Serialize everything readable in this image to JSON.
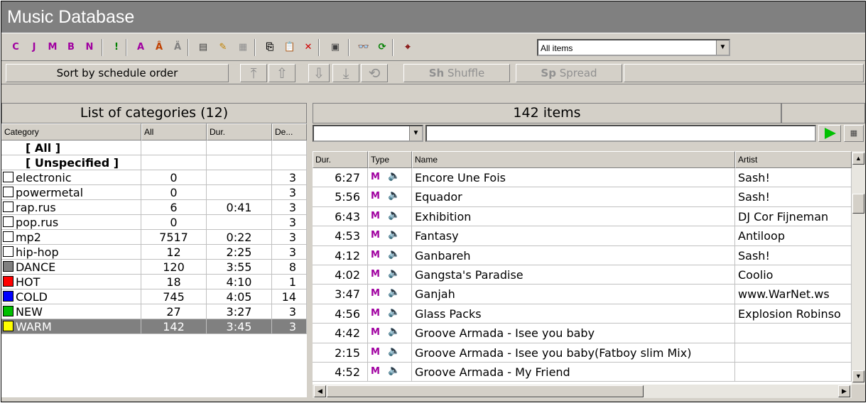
{
  "window": {
    "title": "Music Database"
  },
  "toolbar": {
    "buttons": [
      {
        "glyph": "C",
        "icon": "category-c-icon",
        "color": "#a000a0"
      },
      {
        "glyph": "J",
        "icon": "category-j-icon",
        "color": "#a000a0"
      },
      {
        "glyph": "M",
        "icon": "category-m-icon",
        "color": "#a000a0"
      },
      {
        "glyph": "B",
        "icon": "category-b-icon",
        "color": "#a000a0"
      },
      {
        "glyph": "N",
        "icon": "category-n-icon",
        "color": "#a000a0"
      },
      {
        "glyph": "!",
        "icon": "priority-icon",
        "color": "#008000"
      },
      {
        "glyph": "A",
        "icon": "category-a-icon",
        "color": "#a000a0"
      },
      {
        "glyph": "Â",
        "icon": "category-a2-icon",
        "color": "#c04000"
      },
      {
        "glyph": "Ä",
        "icon": "category-a3-icon",
        "color": "#808080"
      },
      {
        "glyph": "▤",
        "icon": "new-item-icon",
        "color": "#404040"
      },
      {
        "glyph": "✎",
        "icon": "edit-item-icon",
        "color": "#c08000"
      },
      {
        "glyph": "▦",
        "icon": "properties-disabled-icon",
        "color": "#909090"
      },
      {
        "glyph": "⎘",
        "icon": "copy-icon",
        "color": "#000000"
      },
      {
        "glyph": "📋",
        "icon": "paste-icon",
        "color": "#000000"
      },
      {
        "glyph": "✕",
        "icon": "delete-icon",
        "color": "#d00000"
      },
      {
        "glyph": "▣",
        "icon": "settings-icon",
        "color": "#404040"
      },
      {
        "glyph": "👓",
        "icon": "find-icon",
        "color": "#000000"
      },
      {
        "glyph": "⟳",
        "icon": "refresh-icon",
        "color": "#008000"
      },
      {
        "glyph": "⌖",
        "icon": "tool-icon",
        "color": "#800000"
      }
    ],
    "filter_value": "All items"
  },
  "sortbar": {
    "sort_label": "Sort by schedule order",
    "move_top": "⤒",
    "move_up": "⇧",
    "move_down": "⇩",
    "move_bottom": "⤓",
    "loop": "⟲",
    "shuffle_prefix": "Sh",
    "shuffle_label": "Shuffle",
    "spread_prefix": "Sp",
    "spread_label": "Spread"
  },
  "categories": {
    "header": "List of categories (12)",
    "columns": [
      "Category",
      "All",
      "Dur.",
      "De..."
    ],
    "rows": [
      {
        "name": "[ All ]",
        "all": "",
        "dur": "",
        "de": "",
        "bold": true,
        "color": null
      },
      {
        "name": "[ Unspecified ]",
        "all": "",
        "dur": "",
        "de": "",
        "bold": true,
        "color": null
      },
      {
        "name": "electronic",
        "all": "0",
        "dur": "",
        "de": "3",
        "color": "#ffffff"
      },
      {
        "name": "powermetal",
        "all": "0",
        "dur": "",
        "de": "3",
        "color": "#ffffff"
      },
      {
        "name": "rap.rus",
        "all": "6",
        "dur": "0:41",
        "de": "3",
        "color": "#ffffff"
      },
      {
        "name": "pop.rus",
        "all": "0",
        "dur": "",
        "de": "3",
        "color": "#ffffff"
      },
      {
        "name": "mp2",
        "all": "7517",
        "dur": "0:22",
        "de": "3",
        "color": "#ffffff"
      },
      {
        "name": "hip-hop",
        "all": "12",
        "dur": "2:25",
        "de": "3",
        "color": "#ffffff"
      },
      {
        "name": "DANCE",
        "all": "120",
        "dur": "3:55",
        "de": "8",
        "color": "#808080"
      },
      {
        "name": "HOT",
        "all": "18",
        "dur": "4:10",
        "de": "1",
        "color": "#ff0000"
      },
      {
        "name": "COLD",
        "all": "745",
        "dur": "4:05",
        "de": "14",
        "color": "#0000ff"
      },
      {
        "name": "NEW",
        "all": "27",
        "dur": "3:27",
        "de": "3",
        "color": "#00c000"
      },
      {
        "name": "WARM",
        "all": "142",
        "dur": "3:45",
        "de": "3",
        "color": "#ffff00",
        "selected": true
      }
    ]
  },
  "items": {
    "header": "142 items",
    "columns": [
      "Dur.",
      "Type",
      "Name",
      "Artist"
    ],
    "type_glyph": "M",
    "speaker_glyph": "🔈",
    "rows": [
      {
        "dur": "6:27",
        "name": "Encore Une Fois",
        "artist": "Sash!"
      },
      {
        "dur": "5:56",
        "name": "Equador",
        "artist": "Sash!"
      },
      {
        "dur": "6:43",
        "name": "Exhibition",
        "artist": "DJ Cor Fijneman"
      },
      {
        "dur": "4:53",
        "name": "Fantasy",
        "artist": "Antiloop"
      },
      {
        "dur": "4:12",
        "name": "Ganbareh",
        "artist": "Sash!"
      },
      {
        "dur": "4:02",
        "name": "Gangsta's Paradise",
        "artist": "Coolio"
      },
      {
        "dur": "3:47",
        "name": "Ganjah",
        "artist": "www.WarNet.ws"
      },
      {
        "dur": "4:56",
        "name": "Glass Packs",
        "artist": "Explosion Robinso"
      },
      {
        "dur": "4:42",
        "name": "Groove Armada - Isee you baby",
        "artist": ""
      },
      {
        "dur": "2:15",
        "name": "Groove Armada - Isee you baby(Fatboy slim Mix)",
        "artist": ""
      },
      {
        "dur": "4:52",
        "name": "Groove Armada - My Friend",
        "artist": ""
      }
    ]
  }
}
